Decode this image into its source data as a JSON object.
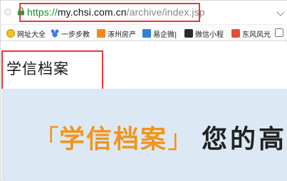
{
  "browser": {
    "url_protocol": "https://",
    "url_host": "my.chsi.com.cn",
    "url_path": "/archive/index.jsp"
  },
  "bookmarks": [
    {
      "label": "网址大全",
      "icon": "globe-icon"
    },
    {
      "label": "一步步教",
      "icon": "paw-icon"
    },
    {
      "label": "涿州房产",
      "icon": "house-icon"
    },
    {
      "label": "易企微|",
      "icon": "document-icon"
    },
    {
      "label": "微信小程",
      "icon": "wechat-icon"
    },
    {
      "label": "东风风光",
      "icon": "brand-icon"
    }
  ],
  "page": {
    "site_title": "学信档案",
    "banner": {
      "bracket_open": "「",
      "brand": "学信档案",
      "bracket_close": "」",
      "rest": "您的高"
    }
  },
  "colors": {
    "highlight": "#e23b3b",
    "brand_orange": "#f0961c",
    "banner_bg": "#dce9f4",
    "url_protocol": "#1a8a2a"
  }
}
